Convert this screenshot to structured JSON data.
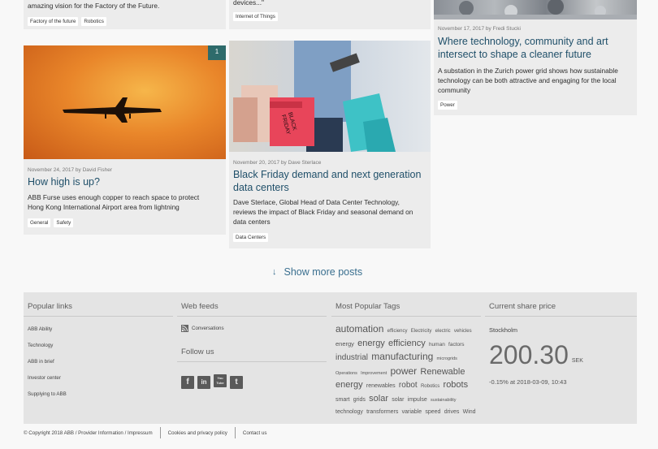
{
  "cards": {
    "partial_left": {
      "desc": "amazing vision for the Factory of the Future.",
      "tags": [
        "Factory of the future",
        "Robotics"
      ]
    },
    "partial_middle": {
      "desc": "devices...\"",
      "tags": [
        "Internet of Things"
      ]
    },
    "right": {
      "meta": "November 17, 2017 by Fredi Stucki",
      "title_line1": "Where technology, community and art",
      "title_line2": "intersect to shape a cleaner future",
      "desc_line1": "A substation in the Zurich power grid shows how sustainable",
      "desc_line2": "technology can be both attractive and engaging for the local",
      "desc_line3": "community",
      "tags": [
        "Power"
      ]
    },
    "left": {
      "badge": "1",
      "meta": "November 24, 2017 by David Fisher",
      "title": "How high is up?",
      "desc_line1": "ABB Furse uses enough copper to reach space to protect",
      "desc_line2": "Hong Kong International Airport area from lightning",
      "tags": [
        "General",
        "Safety"
      ]
    },
    "middle": {
      "meta": "November 20, 2017 by Dave Sterlace",
      "title_line1": "Black Friday demand and next generation",
      "title_line2": "data centers",
      "desc_line1": "Dave Sterlace, Global Head of Data Center Technology,",
      "desc_line2": "reviews the impact of Black Friday and seasonal demand on",
      "desc_line3": "data centers",
      "tags": [
        "Data Centers"
      ],
      "bag_text_1": "BLACK",
      "bag_text_2": "FRIDAY"
    }
  },
  "show_more": {
    "icon": "↓",
    "label": "Show more posts"
  },
  "footer": {
    "popular_links": {
      "heading": "Popular links",
      "items": [
        "ABB Ability",
        "Technology",
        "ABB in brief",
        "Investor center",
        "Supplying to ABB"
      ]
    },
    "web_feeds": {
      "heading": "Web feeds",
      "feed": "Conversations",
      "follow_heading": "Follow us",
      "social": [
        "f",
        "in",
        "You Tube",
        "t"
      ]
    },
    "tags": {
      "heading": "Most Popular Tags",
      "items": [
        {
          "text": "automation",
          "size": 12
        },
        {
          "text": "efficiency",
          "size": 6
        },
        {
          "text": "Electricity",
          "size": 6
        },
        {
          "text": "electric",
          "size": 6
        },
        {
          "text": "vehicles",
          "size": 6
        },
        {
          "text": "energy",
          "size": 7.5
        },
        {
          "text": "energy",
          "size": 11
        },
        {
          "text": "efficiency",
          "size": 11
        },
        {
          "text": "human",
          "size": 6.5
        },
        {
          "text": "factors",
          "size": 6.5
        },
        {
          "text": "industrial",
          "size": 10
        },
        {
          "text": "manufacturing",
          "size": 12
        },
        {
          "text": "microgrids",
          "size": 5.5
        },
        {
          "text": "Operations",
          "size": 5.5
        },
        {
          "text": "Improvement",
          "size": 5.5
        },
        {
          "text": "power",
          "size": 12
        },
        {
          "text": "Renewable",
          "size": 11
        },
        {
          "text": "energy",
          "size": 11
        },
        {
          "text": "renewables",
          "size": 7
        },
        {
          "text": "robot",
          "size": 10
        },
        {
          "text": "Robotics",
          "size": 6
        },
        {
          "text": "robots",
          "size": 11
        },
        {
          "text": "smart",
          "size": 7
        },
        {
          "text": "grids",
          "size": 7
        },
        {
          "text": "solar",
          "size": 11
        },
        {
          "text": "solar",
          "size": 7
        },
        {
          "text": "impulse",
          "size": 7
        },
        {
          "text": "sustainability",
          "size": 5.5
        },
        {
          "text": "technology",
          "size": 7
        },
        {
          "text": "transformers",
          "size": 7
        },
        {
          "text": "variable",
          "size": 7
        },
        {
          "text": "speed",
          "size": 7
        },
        {
          "text": "drives",
          "size": 7
        },
        {
          "text": "Wind",
          "size": 7
        }
      ]
    },
    "share": {
      "heading": "Current share price",
      "exchange": "Stockholm",
      "price": "200.30",
      "currency": "SEK",
      "change": "-0.15% at 2018-03-09, 10:43"
    }
  },
  "bottom_links": [
    "© Copyright 2018 ABB / Provider Information / Impressum",
    "Cookies and privacy policy",
    "Contact us"
  ],
  "colors": {
    "title": "#1f4f69",
    "badge": "#2e6b6b",
    "link": "#3a6f8f"
  }
}
